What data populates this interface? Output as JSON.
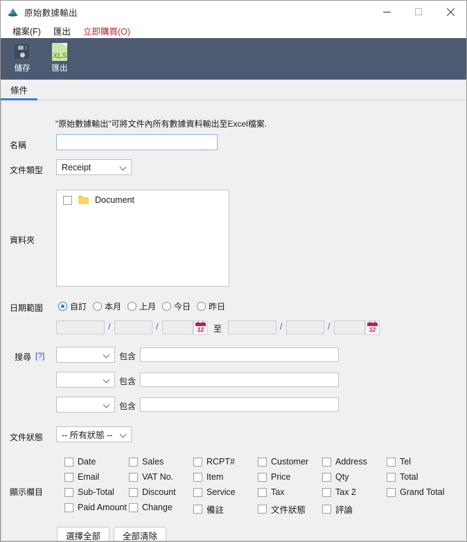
{
  "window": {
    "title": "原始數據輸出",
    "icon": "app-icon",
    "controls": {
      "minimize": "—",
      "maximize": "□",
      "close": "✕"
    }
  },
  "menubar": {
    "items": [
      {
        "label": "檔案(F)",
        "accel": "F",
        "name": "menu-file"
      },
      {
        "label": "匯出",
        "accel": "",
        "name": "menu-export"
      },
      {
        "label": "立即購買(O)",
        "accel": "O",
        "name": "menu-buy-now",
        "color": "#c0252a"
      }
    ]
  },
  "toolbar": {
    "buttons": [
      {
        "label": "儲存",
        "icon": "floppy-disk-icon",
        "name": "toolbar-save"
      },
      {
        "label": "匯出",
        "icon": "xls-file-icon",
        "name": "toolbar-export",
        "icon_text": "XLS"
      }
    ]
  },
  "tabs": [
    {
      "label": "條件",
      "active": true
    }
  ],
  "form": {
    "hint": "\"原始數據輸出\"可將文件內所有數據資料輸出至Excel檔案.",
    "name_label": "名稱",
    "name_value": "",
    "doc_type_label": "文件類型",
    "doc_type_value": "Receipt",
    "folder_label": "資料夾",
    "folder_items": [
      {
        "label": "Document",
        "checked": false
      }
    ],
    "date_range_label": "日期範圍",
    "date_range_options": [
      {
        "label": "自訂",
        "selected": true
      },
      {
        "label": "本月",
        "selected": false
      },
      {
        "label": "上月",
        "selected": false
      },
      {
        "label": "今日",
        "selected": false
      },
      {
        "label": "昨日",
        "selected": false
      }
    ],
    "date_from": {
      "p1": "",
      "p2": "",
      "p3": ""
    },
    "date_to": {
      "p1": "",
      "p2": "",
      "p3": ""
    },
    "date_separator": "/",
    "date_to_label": "至",
    "calendar_icon_text": "12",
    "search_label": "搜尋",
    "search_help": "[?]",
    "search_rows": [
      {
        "field": "",
        "operator": "包含",
        "value": ""
      },
      {
        "field": "",
        "operator": "包含",
        "value": ""
      },
      {
        "field": "",
        "operator": "包含",
        "value": ""
      }
    ],
    "doc_status_label": "文件狀態",
    "doc_status_value": "-- 所有狀態 --",
    "display_columns_label": "顯示欄目",
    "display_columns": [
      {
        "label": "Date",
        "checked": false
      },
      {
        "label": "Sales",
        "checked": false
      },
      {
        "label": "RCPT#",
        "checked": false
      },
      {
        "label": "Customer",
        "checked": false
      },
      {
        "label": "Address",
        "checked": false
      },
      {
        "label": "Tel",
        "checked": false
      },
      {
        "label": "Email",
        "checked": false
      },
      {
        "label": "VAT No.",
        "checked": false
      },
      {
        "label": "Item",
        "checked": false
      },
      {
        "label": "Price",
        "checked": false
      },
      {
        "label": "Qty",
        "checked": false
      },
      {
        "label": "Total",
        "checked": false
      },
      {
        "label": "Sub-Total",
        "checked": false
      },
      {
        "label": "Discount",
        "checked": false
      },
      {
        "label": "Service",
        "checked": false
      },
      {
        "label": "Tax",
        "checked": false
      },
      {
        "label": "Tax 2",
        "checked": false
      },
      {
        "label": "Grand Total",
        "checked": false
      },
      {
        "label": "Paid Amount",
        "checked": false
      },
      {
        "label": "Change",
        "checked": false
      },
      {
        "label": "備註",
        "checked": false
      },
      {
        "label": "文件狀態",
        "checked": false
      },
      {
        "label": "評論",
        "checked": false
      }
    ],
    "select_all_label": "選擇全部",
    "clear_all_label": "全部清除"
  },
  "colors": {
    "toolbar_bg": "#4c5a72",
    "accent": "#3b7dd8",
    "buy_red": "#c0252a",
    "calendar": "#c2185b",
    "xls_green": "#6cae3e",
    "folder_yellow": "#fcd462"
  }
}
